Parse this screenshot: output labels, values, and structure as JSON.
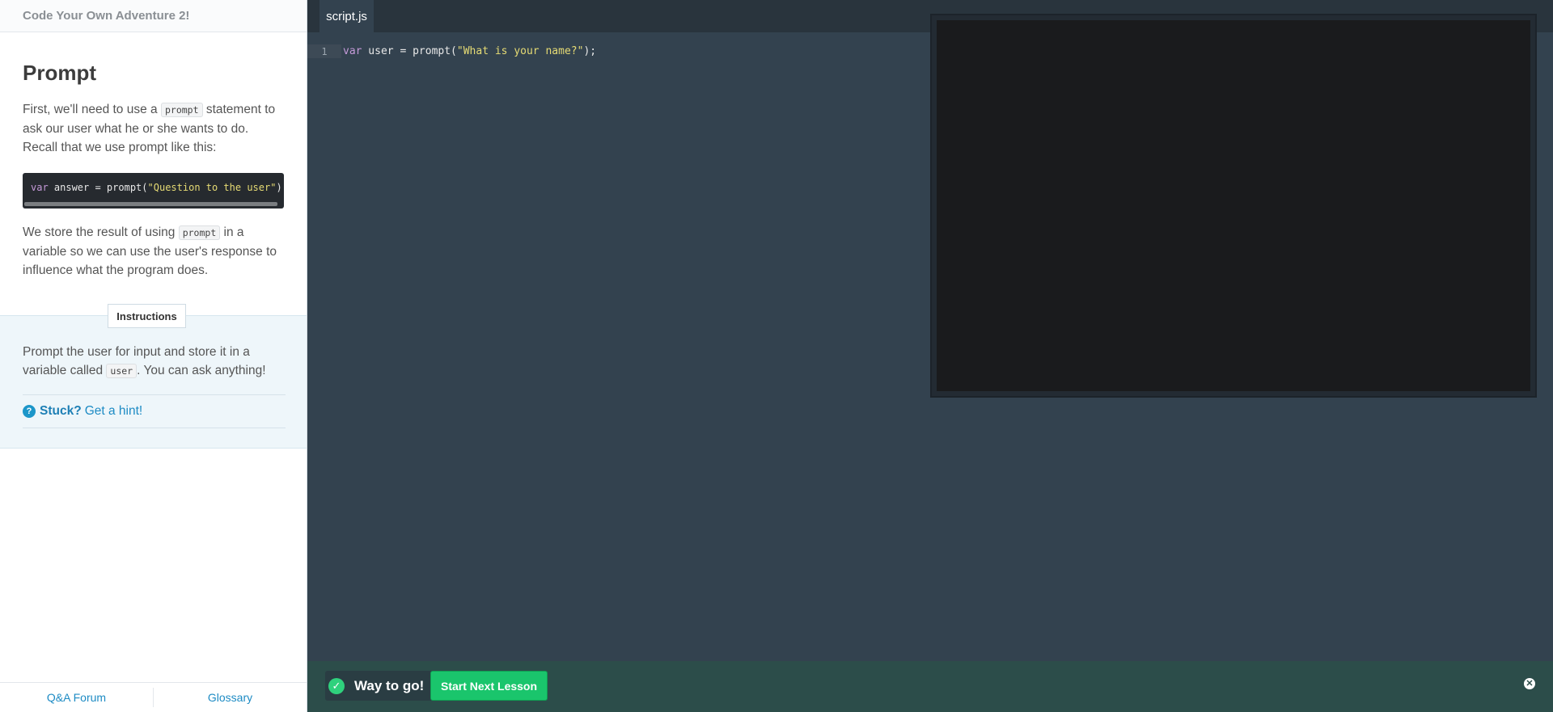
{
  "course": {
    "title": "Code Your Own Adventure 2!"
  },
  "lesson": {
    "heading": "Prompt",
    "p1_before": "First, we'll need to use a ",
    "p1_code": "prompt",
    "p1_after": " statement to ask our user what he or she wants to do. Recall that we use prompt like this:",
    "example_kw": "var",
    "example_mid": " answer = prompt(",
    "example_str": "\"Question to the user\"",
    "example_end": ");",
    "p2_before": "We store the result of using ",
    "p2_code": "prompt",
    "p2_after": " in a variable so we can use the user's response to influence what the program does."
  },
  "instructions": {
    "tag": "Instructions",
    "text_before": "Prompt the user for input and store it in a variable called ",
    "text_code": "user",
    "text_after": ". You can ask anything!",
    "stuck_label": "Stuck?",
    "hint_link": "Get a hint!"
  },
  "footer": {
    "qa": "Q&A Forum",
    "glossary": "Glossary"
  },
  "editor": {
    "tab": "script.js",
    "line_number": "1",
    "line_kw": "var",
    "line_mid": " user = prompt(",
    "line_str": "\"What is your name?\"",
    "line_end": ");"
  },
  "result": {
    "message": "Way to go!",
    "next_button": "Start Next Lesson"
  },
  "icons": {
    "help": "question-circle-icon",
    "check": "check-circle-icon",
    "close": "close-icon"
  },
  "colors": {
    "accent": "#1d8bc4",
    "success": "#1ac56c",
    "editor_bg": "#33424f"
  }
}
